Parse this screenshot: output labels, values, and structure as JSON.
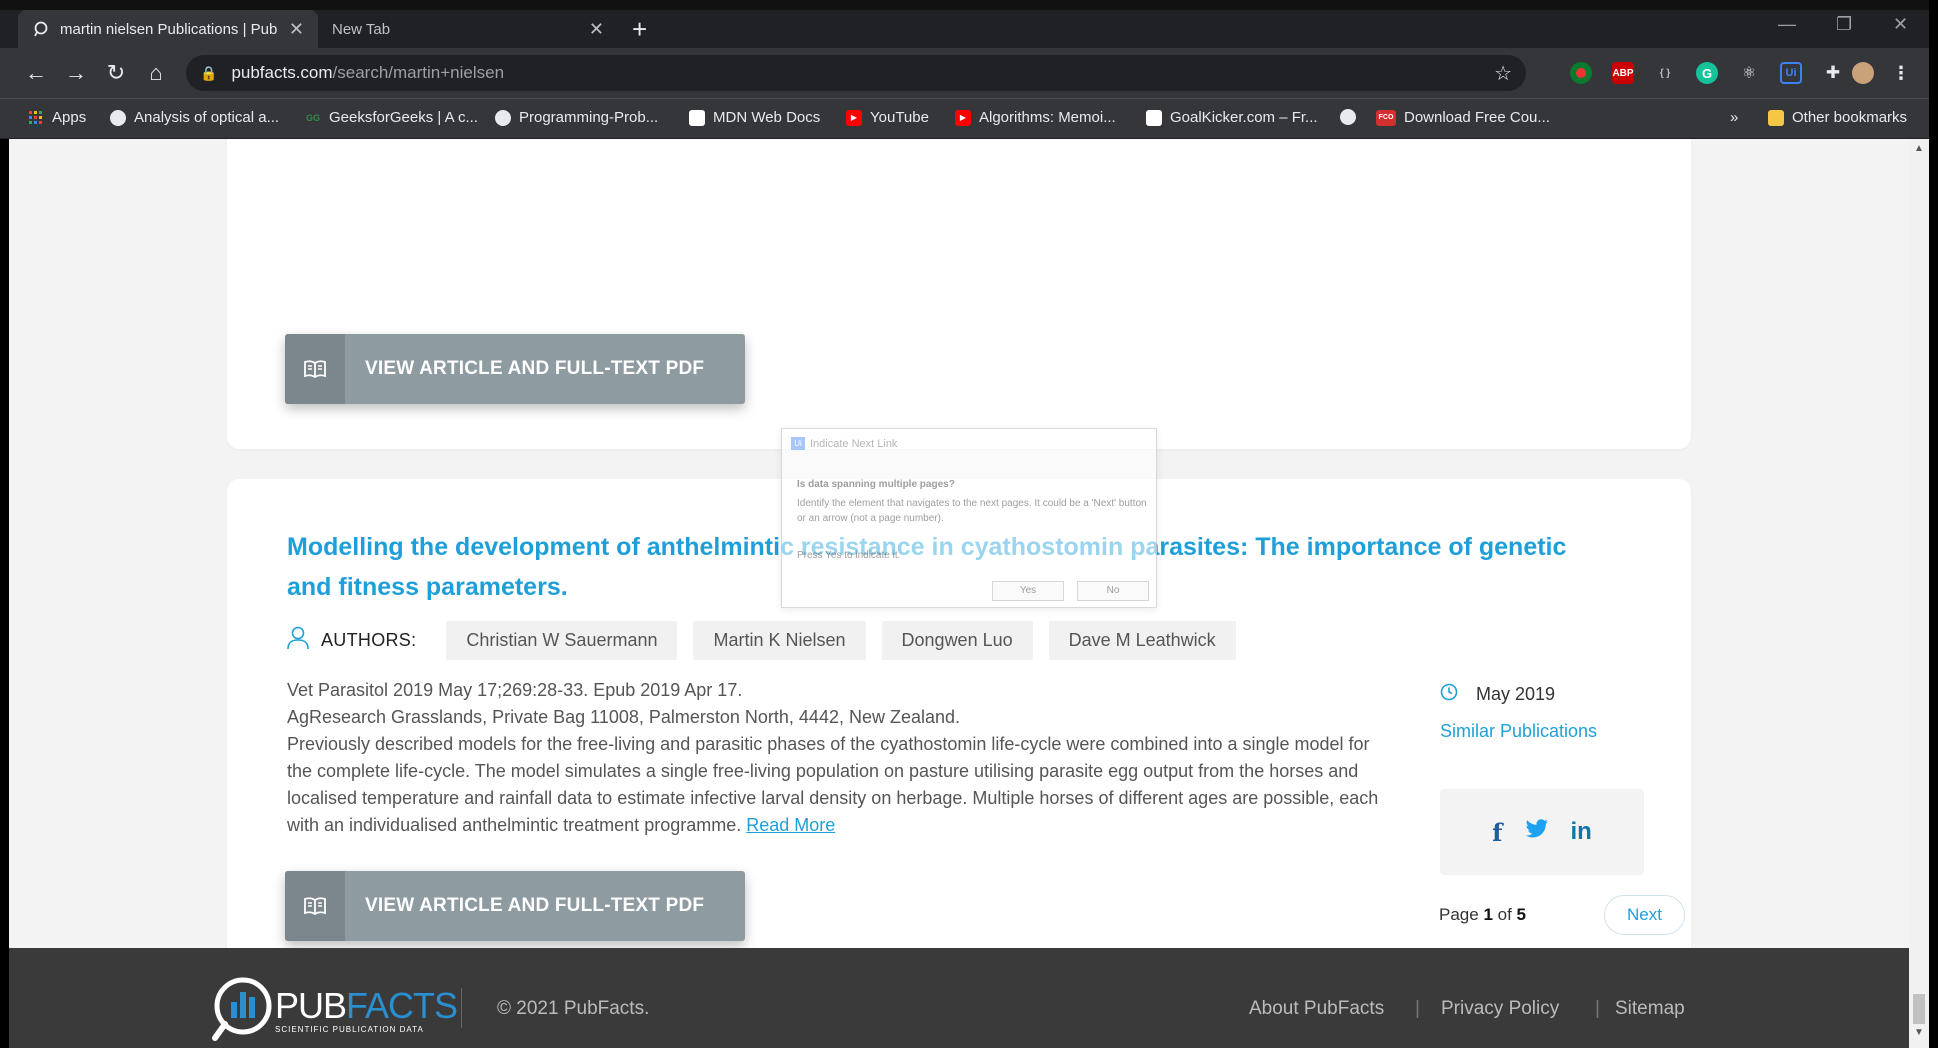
{
  "browser": {
    "tabs": [
      {
        "label": "martin nielsen Publications | Pub",
        "active": true
      },
      {
        "label": "New Tab",
        "active": false
      }
    ],
    "url_host": "pubfacts.com",
    "url_path": "/search/martin+nielsen",
    "bookmarks": [
      {
        "label": "Apps",
        "icon": "apps-grid-icon"
      },
      {
        "label": "Analysis of optical a...",
        "icon": "globe-icon"
      },
      {
        "label": "GeeksforGeeks | A c...",
        "icon": "gfg-icon"
      },
      {
        "label": "Programming-Prob...",
        "icon": "github-icon"
      },
      {
        "label": "MDN Web Docs",
        "icon": "mdn-icon"
      },
      {
        "label": "YouTube",
        "icon": "youtube-icon"
      },
      {
        "label": "Algorithms: Memoi...",
        "icon": "youtube-icon"
      },
      {
        "label": "GoalKicker.com – Fr...",
        "icon": "goalkicker-icon"
      },
      {
        "label": "Download Free Cou...",
        "icon": "fco-icon"
      }
    ],
    "more_bookmarks": "»",
    "other_bookmarks": "Other bookmarks",
    "ext_abp": "ABP",
    "ext_fco": "FCO"
  },
  "card1": {
    "pdf_button": "VIEW ARTICLE AND FULL-TEXT PDF"
  },
  "article": {
    "title": "Modelling the development of anthelmintic resistance in cyathostomin parasites: The importance of genetic and fitness parameters.",
    "authors_label": "AUTHORS:",
    "authors": [
      "Christian W Sauermann",
      "Martin K Nielsen",
      "Dongwen Luo",
      "Dave M Leathwick"
    ],
    "citation": "Vet Parasitol 2019 May 17;269:28-33. Epub 2019 Apr 17.",
    "affiliation": "AgResearch Grasslands, Private Bag 11008, Palmerston North, 4442, New Zealand.",
    "abstract": "Previously described models for the free-living and parasitic phases of the cyathostomin life-cycle were combined into a single model for the complete life-cycle. The model simulates a single free-living population on pasture utilising parasite egg output from the horses and localised temperature and rainfall data to estimate infective larval density on herbage. Multiple horses of different ages are possible, each with an individualised anthelmintic treatment programme.",
    "read_more": "Read More",
    "date": "May 2019",
    "similar_link": "Similar Publications",
    "pdf_button": "VIEW ARTICLE AND FULL-TEXT PDF",
    "share": {
      "facebook": "f",
      "twitter": "🐦",
      "linkedin": "in"
    }
  },
  "pagination": {
    "prefix": "Page ",
    "current": "1",
    "of": " of ",
    "total": "5",
    "next_label": "Next"
  },
  "footer": {
    "brand_pub": "PUB",
    "brand_facts": "FACTS",
    "tagline": "SCIENTIFIC PUBLICATION DATA",
    "copyright": "© 2021 PubFacts.",
    "links": [
      "About PubFacts",
      "Privacy Policy",
      "Sitemap"
    ]
  },
  "ghost_dialog": {
    "title": "Indicate Next Link",
    "question": "Is data spanning multiple pages?",
    "description": "Identify the element that navigates to the next pages. It could be a 'Next' button or an arrow (not a page number).",
    "press": "Press Yes to indicate it.",
    "yes": "Yes",
    "no": "No"
  },
  "colors": {
    "accent": "#1f9fd9",
    "pdf_button": "#8e9ba0",
    "footer_bg": "#3a3a3a",
    "page_bg": "#f3f3f3"
  }
}
